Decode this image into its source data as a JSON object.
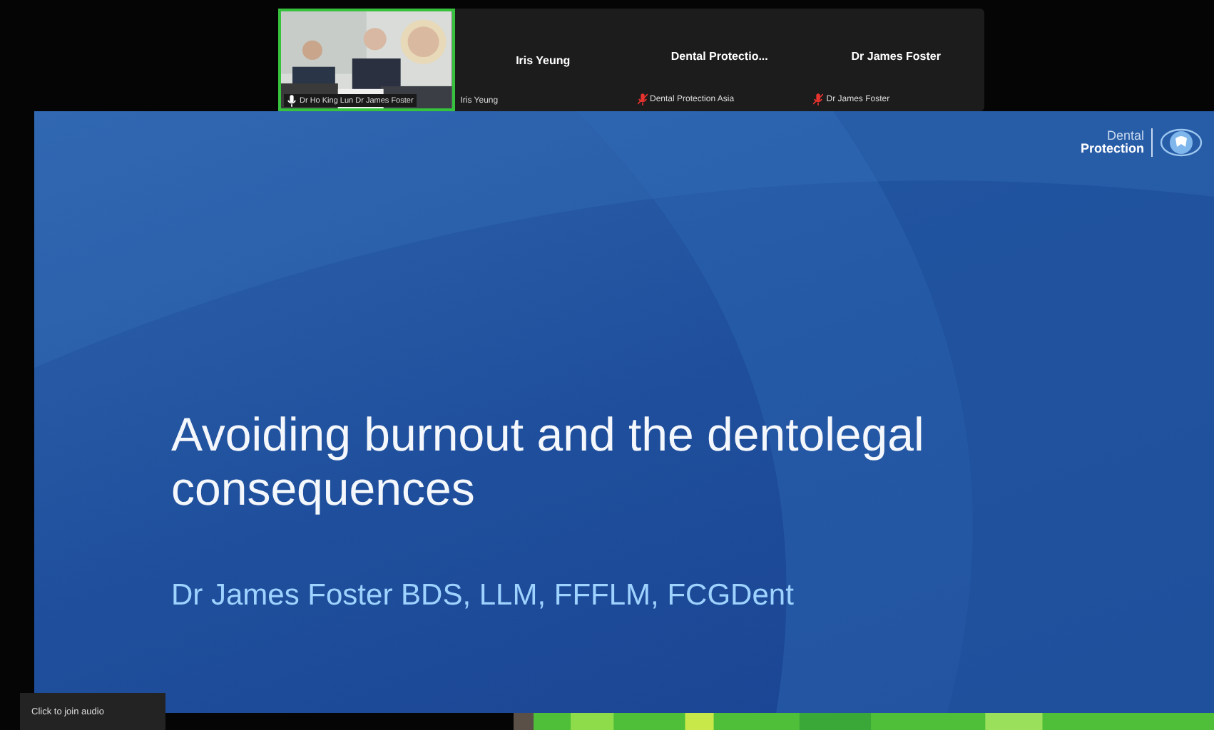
{
  "gallery": [
    {
      "kind": "video",
      "name_label": "Dr Ho King Lun Dr James Foster",
      "active": true
    },
    {
      "kind": "name",
      "display_name": "Iris Yeung",
      "name_label": "Iris Yeung",
      "active": false,
      "muted": false
    },
    {
      "kind": "name",
      "display_name": "Dental  Protectio...",
      "name_label": "Dental Protection Asia",
      "active": false,
      "muted": true
    },
    {
      "kind": "name",
      "display_name": "Dr James Foster",
      "name_label": "Dr James Foster",
      "active": false,
      "muted": true
    }
  ],
  "slide": {
    "logo_line_1": "Dental",
    "logo_line_2": "Protection",
    "title": "Avoiding burnout and the dentolegal consequences",
    "presenter": "Dr James Foster BDS, LLM, FFFLM, FCGDent"
  },
  "audio_tooltip": "Click to join audio"
}
